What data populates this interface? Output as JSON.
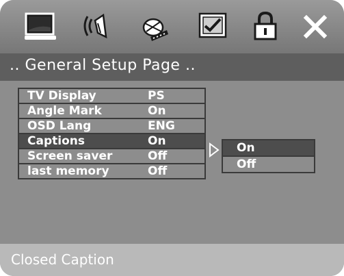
{
  "icons": [
    {
      "name": "tv-display-icon"
    },
    {
      "name": "audio-speaker-icon"
    },
    {
      "name": "video-disc-icon"
    },
    {
      "name": "preferences-checklist-icon"
    },
    {
      "name": "password-lock-icon"
    },
    {
      "name": "exit-close-icon"
    }
  ],
  "header": {
    "title": ".. General Setup Page .."
  },
  "settings": [
    {
      "label": "TV Display",
      "value": "PS"
    },
    {
      "label": "Angle Mark",
      "value": "On"
    },
    {
      "label": "OSD Lang",
      "value": "ENG"
    },
    {
      "label": "Captions",
      "value": "On"
    },
    {
      "label": "Screen saver",
      "value": "Off"
    },
    {
      "label": "last memory",
      "value": "Off"
    }
  ],
  "selected_setting": "Captions",
  "submenu": {
    "options": [
      "On",
      "Off"
    ],
    "selected": "On"
  },
  "footer": {
    "hint": "Closed Caption"
  }
}
